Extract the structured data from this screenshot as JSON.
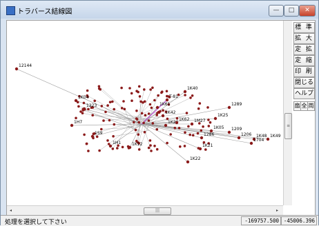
{
  "window": {
    "title": "トラバース結線図",
    "controls": {
      "minimize": "—",
      "maximize": "□",
      "close": "✕"
    }
  },
  "icons": {
    "app": "traverse-app-icon"
  },
  "side_buttons": [
    "標 準",
    "拡 大",
    "定 拡",
    "定 縮",
    "印 刷",
    "閉じる",
    "ヘルプ"
  ],
  "small_buttons": [
    "扇",
    "全",
    "両"
  ],
  "plot": {
    "origin_label": "",
    "station_labels": [
      "12144",
      "1K40",
      "T-81",
      "1K61",
      "1K42",
      "1289",
      "1K26",
      "1M27",
      "1K25",
      "1K05",
      "1K62",
      "1209",
      "1206",
      "1K48",
      "1K49",
      "1K21",
      "1K22",
      "1K12",
      "1H7",
      "1S9",
      "1H1",
      "1223",
      "1K04",
      "1286",
      "1704"
    ],
    "point_color": "#8b1a1a",
    "line_color": "#9a9a9a",
    "highlight_color": "#c04bd9"
  },
  "statusbar": {
    "message": "処理を選択して下さい",
    "x": "-169757.500",
    "y": "-45006.396"
  }
}
